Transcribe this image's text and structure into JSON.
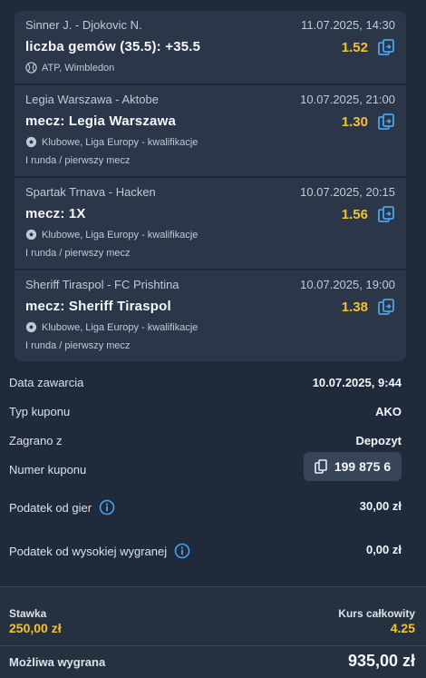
{
  "bets": [
    {
      "match": "Sinner J. - Djokovic N.",
      "date": "11.07.2025, 14:30",
      "pick": "liczba gemów (35.5): +35.5",
      "odd": "1.52",
      "league": "ATP, Wimbledon",
      "round": "",
      "sport_icon": "tennis-ball-icon"
    },
    {
      "match": "Legia Warszawa - Aktobe",
      "date": "10.07.2025, 21:00",
      "pick": "mecz: Legia Warszawa",
      "odd": "1.30",
      "league": "Klubowe, Liga Europy - kwalifikacje",
      "round": "I runda / pierwszy mecz",
      "sport_icon": "soccer-ball-icon"
    },
    {
      "match": "Spartak Trnava - Hacken",
      "date": "10.07.2025, 20:15",
      "pick": "mecz: 1X",
      "odd": "1.56",
      "league": "Klubowe, Liga Europy - kwalifikacje",
      "round": "I runda / pierwszy mecz",
      "sport_icon": "soccer-ball-icon"
    },
    {
      "match": "Sheriff Tiraspol - FC Prishtina",
      "date": "10.07.2025, 19:00",
      "pick": "mecz: Sheriff Tiraspol",
      "odd": "1.38",
      "league": "Klubowe, Liga Europy - kwalifikacje",
      "round": "I runda / pierwszy mecz",
      "sport_icon": "soccer-ball-icon"
    }
  ],
  "details": {
    "date_label": "Data zawarcia",
    "date_value": "10.07.2025, 9:44",
    "type_label": "Typ kuponu",
    "type_value": "AKO",
    "played_label": "Zagrano z",
    "played_value": "Depozyt",
    "number_label": "Numer kuponu",
    "number_value": "199 875 6",
    "tax_label": "Podatek od gier",
    "tax_value": "30,00 zł",
    "high_tax_label": "Podatek od wysokiej wygranej",
    "high_tax_value": "0,00 zł"
  },
  "footer": {
    "stake_label": "Stawka",
    "stake_value": "250,00 zł",
    "total_label": "Kurs całkowity",
    "total_value": "4.25",
    "win_label": "Możliwa wygrana",
    "win_value": "935,00 zł"
  },
  "colors": {
    "background": "#1f2a3a",
    "card": "#2b3648",
    "accent": "#f3c136",
    "icon_blue": "#4aa3e8"
  }
}
